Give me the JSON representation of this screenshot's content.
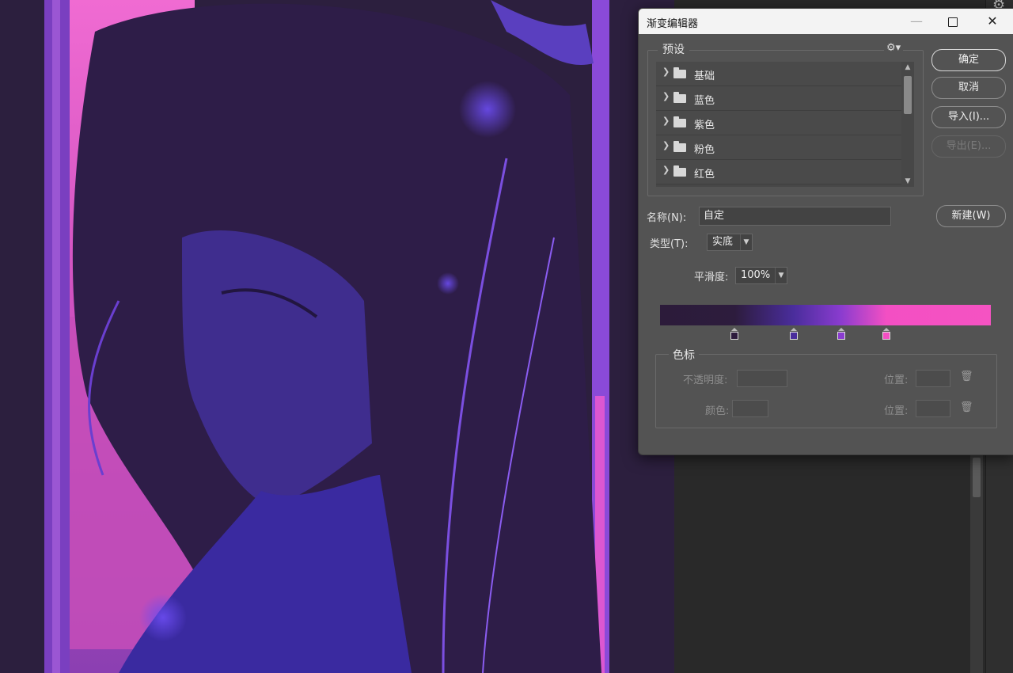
{
  "dialog": {
    "title": "渐变编辑器",
    "window_controls": {
      "minimize": "—",
      "maximize": "□",
      "close": "✕"
    },
    "presets": {
      "label": "预设",
      "gear_icon": "gear-icon",
      "items": [
        {
          "label": "基础"
        },
        {
          "label": "蓝色"
        },
        {
          "label": "紫色"
        },
        {
          "label": "粉色"
        },
        {
          "label": "红色"
        }
      ]
    },
    "buttons": {
      "ok": "确定",
      "cancel": "取消",
      "import": "导入(I)...",
      "export": "导出(E)...",
      "new": "新建(W)"
    },
    "name": {
      "label": "名称(N):",
      "value": "自定"
    },
    "type": {
      "label": "类型(T):",
      "value": "实底"
    },
    "smoothness": {
      "label": "平滑度:",
      "value": "100%"
    },
    "gradient": {
      "stops": [
        {
          "color": "#2d1c3d",
          "location_percent": 22.6
        },
        {
          "color": "#4a2d9c",
          "location_percent": 40.4
        },
        {
          "color": "#8a3ccf",
          "location_percent": 54.7
        },
        {
          "color": "#f34fc3",
          "location_percent": 68.4
        }
      ]
    },
    "color_stops": {
      "label": "色标",
      "opacity_label": "不透明度:",
      "position_label_1": "位置:",
      "color_label": "颜色:",
      "position_label_2": "位置:"
    }
  },
  "background": {
    "description_colors": {
      "dark": "#2c1f3e",
      "pink": "#ee55c8",
      "violet": "#4a32a8"
    }
  }
}
